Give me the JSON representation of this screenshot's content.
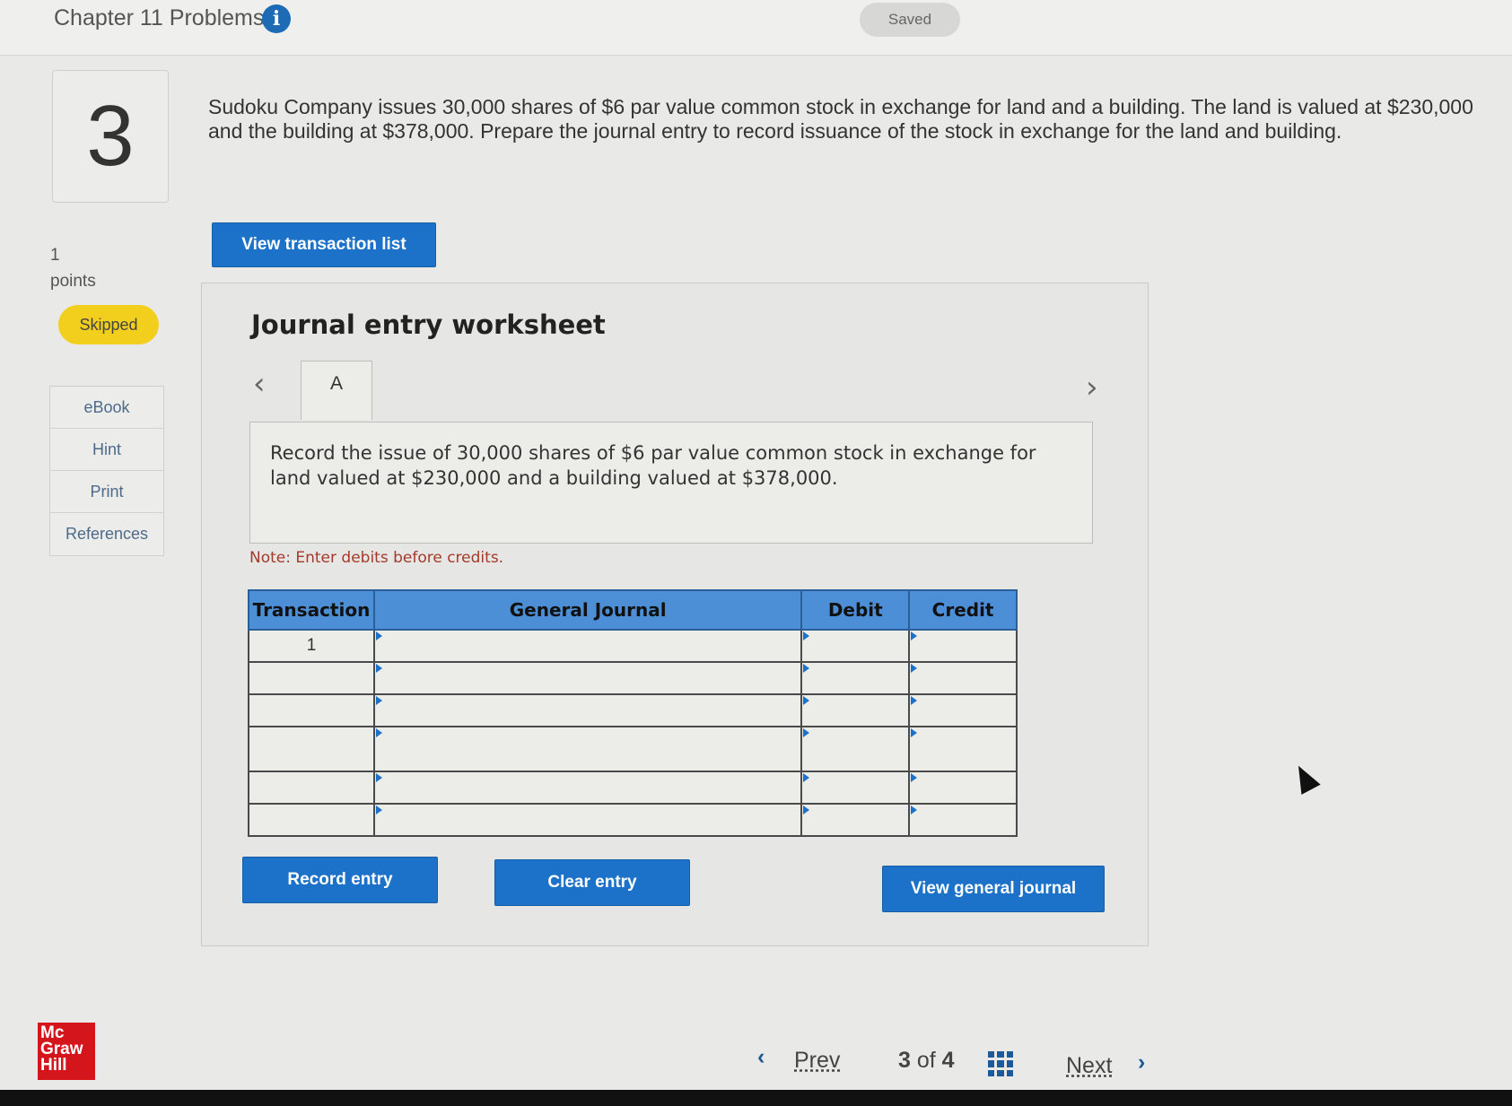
{
  "header": {
    "chapter_title": "Chapter 11 Problems",
    "info_icon": "info-icon",
    "saved_label": "Saved"
  },
  "question": {
    "number": "3",
    "text": "Sudoku Company issues 30,000 shares of $6 par value common stock in exchange for land and a building. The land is valued at $230,000 and the building at $378,000. Prepare the journal entry to record issuance of the stock in exchange for the land and building.",
    "points_value": "1",
    "points_label": "points",
    "status": "Skipped"
  },
  "sidebar": {
    "tools": [
      {
        "label": "eBook"
      },
      {
        "label": "Hint"
      },
      {
        "label": "Print"
      },
      {
        "label": "References"
      }
    ]
  },
  "buttons": {
    "view_transaction_list": "View transaction list",
    "record_entry": "Record entry",
    "clear_entry": "Clear entry",
    "view_general_journal": "View general journal"
  },
  "worksheet": {
    "title": "Journal entry worksheet",
    "tab_label": "A",
    "instruction": "Record the issue of 30,000 shares of $6 par value common stock in exchange for land valued at $230,000 and a building valued at $378,000.",
    "note": "Note: Enter debits before credits.",
    "columns": [
      "Transaction",
      "General Journal",
      "Debit",
      "Credit"
    ],
    "rows": [
      {
        "transaction": "1",
        "account": "",
        "debit": "",
        "credit": ""
      },
      {
        "transaction": "",
        "account": "",
        "debit": "",
        "credit": ""
      },
      {
        "transaction": "",
        "account": "",
        "debit": "",
        "credit": ""
      },
      {
        "transaction": "",
        "account": "",
        "debit": "",
        "credit": ""
      },
      {
        "transaction": "",
        "account": "",
        "debit": "",
        "credit": ""
      },
      {
        "transaction": "",
        "account": "",
        "debit": "",
        "credit": ""
      }
    ]
  },
  "footer": {
    "logo_lines": [
      "Mc",
      "Graw",
      "Hill"
    ],
    "prev_label": "Prev",
    "page_current": "3",
    "page_of": "of",
    "page_total": "4",
    "next_label": "Next"
  },
  "colors": {
    "accent_blue": "#1c72c8",
    "table_header": "#4d8fd6",
    "skipped_yellow": "#f3cf1d",
    "note_red": "#a53a2a",
    "brand_red": "#d4161c"
  }
}
